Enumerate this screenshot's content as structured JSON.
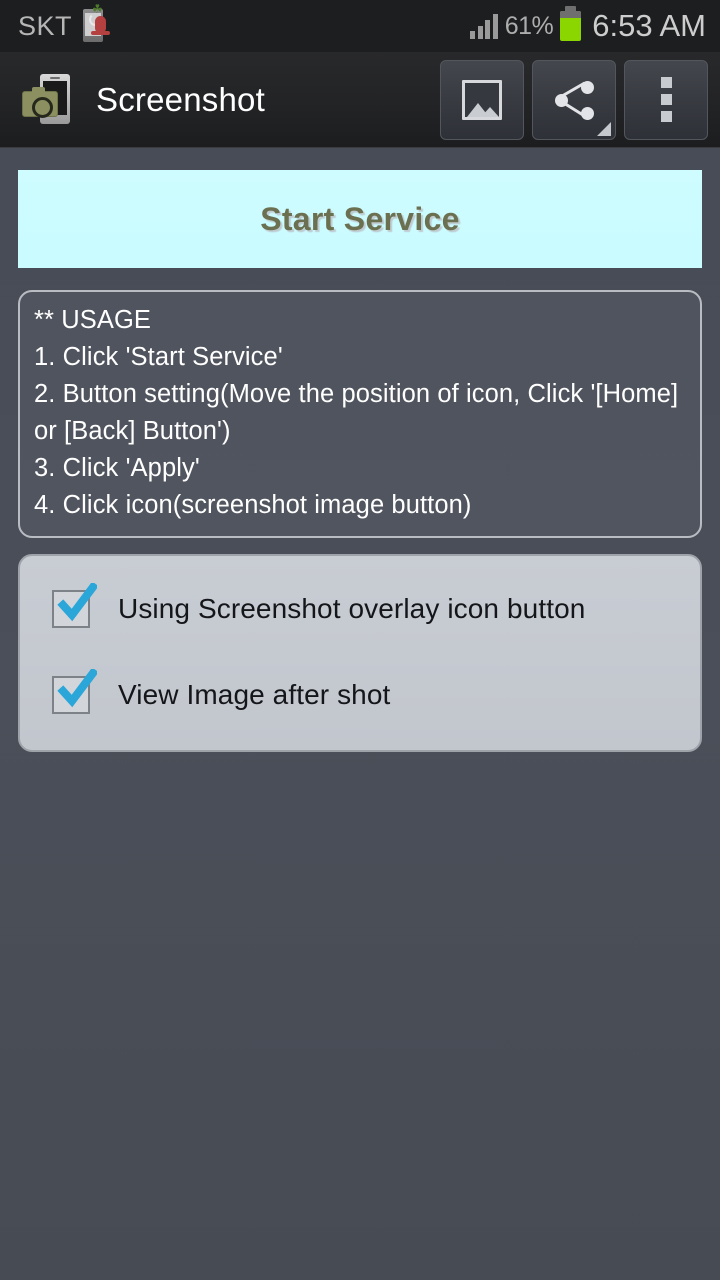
{
  "status_bar": {
    "carrier": "SKT",
    "carrier_icon": "phone-mic-icon",
    "signal_icon": "signal-bars-icon",
    "battery_percent": "61%",
    "battery_icon": "battery-icon",
    "clock": "6:53 AM"
  },
  "action_bar": {
    "app_icon": "screenshot-app-icon",
    "title": "Screenshot",
    "buttons": [
      {
        "name": "gallery-button",
        "icon": "gallery-icon"
      },
      {
        "name": "share-button",
        "icon": "share-icon"
      },
      {
        "name": "overflow-menu-button",
        "icon": "overflow-menu-icon"
      }
    ]
  },
  "main": {
    "start_service_label": "Start Service",
    "usage": {
      "lines": [
        "** USAGE",
        "1. Click 'Start Service'",
        "2. Button setting(Move the position of icon, Click '[Home] or [Back] Button')",
        "3. Click 'Apply'",
        "4. Click icon(screenshot image button)"
      ]
    },
    "options": [
      {
        "label": "Using Screenshot overlay icon button",
        "checked": true
      },
      {
        "label": "View Image after shot",
        "checked": true
      }
    ]
  },
  "colors": {
    "background": "#474b55",
    "status_bar": "#1d1e1f",
    "action_bar": "#222325",
    "start_service_bg": "#ccfbff",
    "start_service_text": "#6b7050",
    "options_card_bg": "#c5c9d0",
    "checkbox_tick": "#2ba6d9",
    "battery_green": "#8bd600"
  }
}
